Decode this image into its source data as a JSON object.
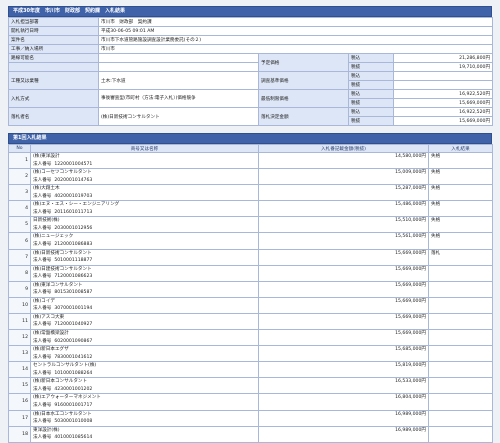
{
  "header_title": "平成30年度　市川市　財政部　契約課　入札結果",
  "info": {
    "rows": [
      {
        "label": "入札担当部署",
        "value": "市川市　財政部　契約課"
      },
      {
        "label": "開札執行日時",
        "value": "平成30-06-05 09:01 AM"
      },
      {
        "label": "案件名",
        "value": "市川市下水道管路施設調査設計業務委託(その２)"
      },
      {
        "label": "工事／納入場所",
        "value": "市川市"
      }
    ],
    "route_label": "路線可能名",
    "category_label": "工種又は業種",
    "category_value": "土木:下水道",
    "method_label": "入札方式",
    "method_value": "事後審査型(市町村（方法:電子入札）)価格競争",
    "winner_label": "落札者名",
    "winner_value": "(株)日新技術コンサルタント",
    "planned_price_label": "予定価格",
    "survey_price_label": "調査基準価格",
    "min_price_label": "最低制限価格",
    "decided_price_label": "落札決定金額",
    "tax_in": "税込",
    "tax_ex": "税抜",
    "planned_in": "21,286,800円",
    "planned_ex": "19,710,000円",
    "min_in": "16,922,520円",
    "min_ex": "15,669,000円",
    "decided_in": "16,922,520円",
    "decided_ex": "15,669,000円"
  },
  "results": {
    "header_title": "第1回入札結果",
    "col_no": "No",
    "col_name": "商号又は名称",
    "col_amount": "入札番記載金額(税抜)",
    "col_result": "入札結果",
    "reg_label": "法人番号",
    "rows": [
      {
        "no": "1",
        "name": "(株)東洋設計",
        "reg": "1220001004571",
        "amount": "14,580,000円",
        "result": "失格"
      },
      {
        "no": "2",
        "name": "(株)コーセツコンサルタント",
        "reg": "2020001014763",
        "amount": "15,009,000円",
        "result": "失格"
      },
      {
        "no": "3",
        "name": "(株)大翔土木",
        "reg": "4020001019703",
        "amount": "15,287,000円",
        "result": "失格"
      },
      {
        "no": "4",
        "name": "(株)エヌ・エス・シー・エンジニアリング",
        "reg": "2011601011713",
        "amount": "15,486,000円",
        "result": "失格"
      },
      {
        "no": "5",
        "name": "日新技術(株)",
        "reg": "2030001012956",
        "amount": "15,510,000円",
        "result": "失格"
      },
      {
        "no": "6",
        "name": "(株)ニュージェック",
        "reg": "2120001086883",
        "amount": "15,561,000円",
        "result": "失格"
      },
      {
        "no": "7",
        "name": "(株)日新技術コンサルタント",
        "reg": "5010001118877",
        "amount": "15,669,000円",
        "result": "落札"
      },
      {
        "no": "8",
        "name": "(株)日建技術コンサルタント",
        "reg": "7120001086623",
        "amount": "15,669,000円",
        "result": ""
      },
      {
        "no": "9",
        "name": "(株)東洋コンサルタント",
        "reg": "8015301008587",
        "amount": "15,669,000円",
        "result": ""
      },
      {
        "no": "10",
        "name": "(株)コイデ",
        "reg": "3070001001194",
        "amount": "15,669,000円",
        "result": ""
      },
      {
        "no": "11",
        "name": "(株)アスコ大東",
        "reg": "7120001040927",
        "amount": "15,669,000円",
        "result": ""
      },
      {
        "no": "12",
        "name": "(株)常盤橋梁設計",
        "reg": "6020001090867",
        "amount": "15,669,000円",
        "result": ""
      },
      {
        "no": "13",
        "name": "(株)新日本エグザ",
        "reg": "7830001041612",
        "amount": "15,685,000円",
        "result": ""
      },
      {
        "no": "14",
        "name": "セントラルコンサルタント(株)",
        "reg": "1010001088264",
        "amount": "15,819,000円",
        "result": ""
      },
      {
        "no": "15",
        "name": "(株)新日本コンサルタント",
        "reg": "4230001001202",
        "amount": "16,533,000円",
        "result": ""
      },
      {
        "no": "16",
        "name": "(株)エアウォーターマネジメント",
        "reg": "9160001001717",
        "amount": "16,804,000円",
        "result": ""
      },
      {
        "no": "17",
        "name": "(株)日本水工コンサルタント",
        "reg": "5030001010008",
        "amount": "16,989,000円",
        "result": ""
      },
      {
        "no": "18",
        "name": "東洋設計(株)",
        "reg": "4010001085614",
        "amount": "16,989,000円",
        "result": ""
      }
    ]
  }
}
